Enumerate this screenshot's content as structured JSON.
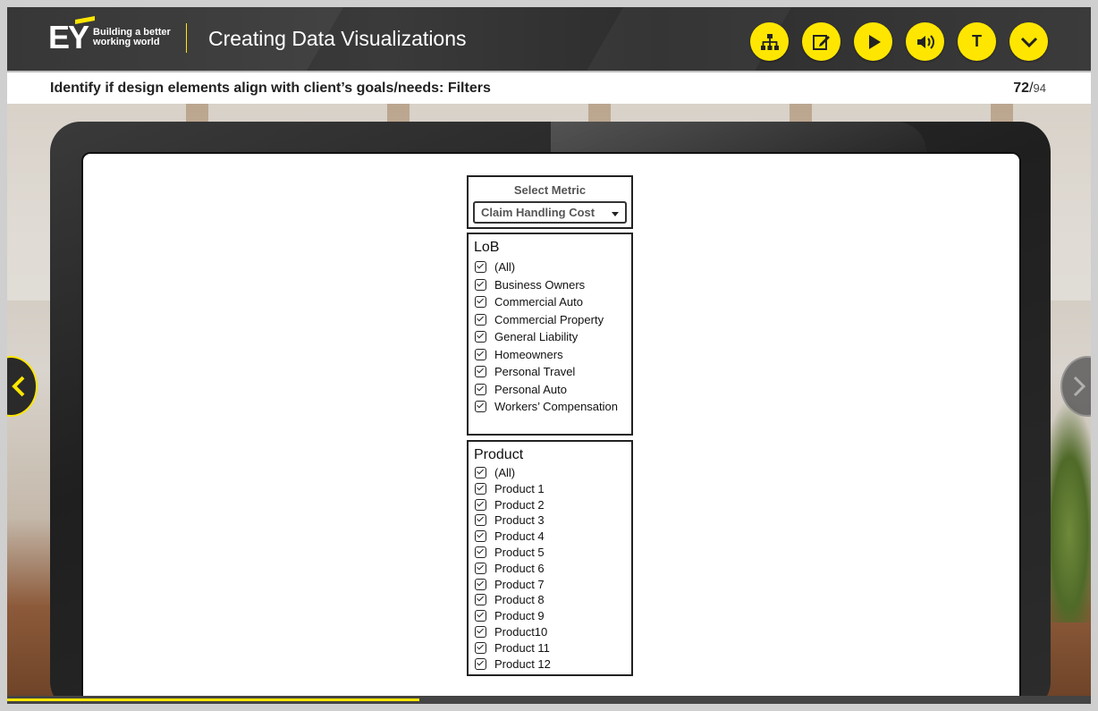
{
  "header": {
    "logo_text": "EY",
    "logo_tagline": "Building a better working world",
    "course_title": "Creating Data Visualizations",
    "tools": [
      {
        "name": "sitemap-icon"
      },
      {
        "name": "notes-icon"
      },
      {
        "name": "play-icon"
      },
      {
        "name": "audio-icon"
      },
      {
        "name": "text-icon",
        "label": "T"
      },
      {
        "name": "chevron-down-icon"
      }
    ],
    "accent_color": "#ffe600"
  },
  "subheader": {
    "title": "Identify if design elements align with client’s goals/needs: Filters",
    "current_page": "72",
    "separator": "/",
    "total_pages": "94"
  },
  "metric": {
    "label": "Select Metric",
    "selected": "Claim Handling Cost"
  },
  "lob_filter": {
    "title": "LoB",
    "items": [
      "(All)",
      "Business  Owners",
      "Commercial Auto",
      "Commercial Property",
      "General Liability",
      "Homeowners",
      "Personal Travel",
      "Personal Auto",
      "Workers’ Compensation"
    ]
  },
  "product_filter": {
    "title": "Product",
    "items": [
      "(All)",
      "Product 1",
      "Product 2",
      "Product 3",
      "Product 4",
      "Product 5",
      "Product 6",
      "Product 7",
      "Product 8",
      "Product 9",
      "Product10",
      "Product 11",
      "Product 12"
    ]
  },
  "progress": {
    "fraction": 0.38
  }
}
